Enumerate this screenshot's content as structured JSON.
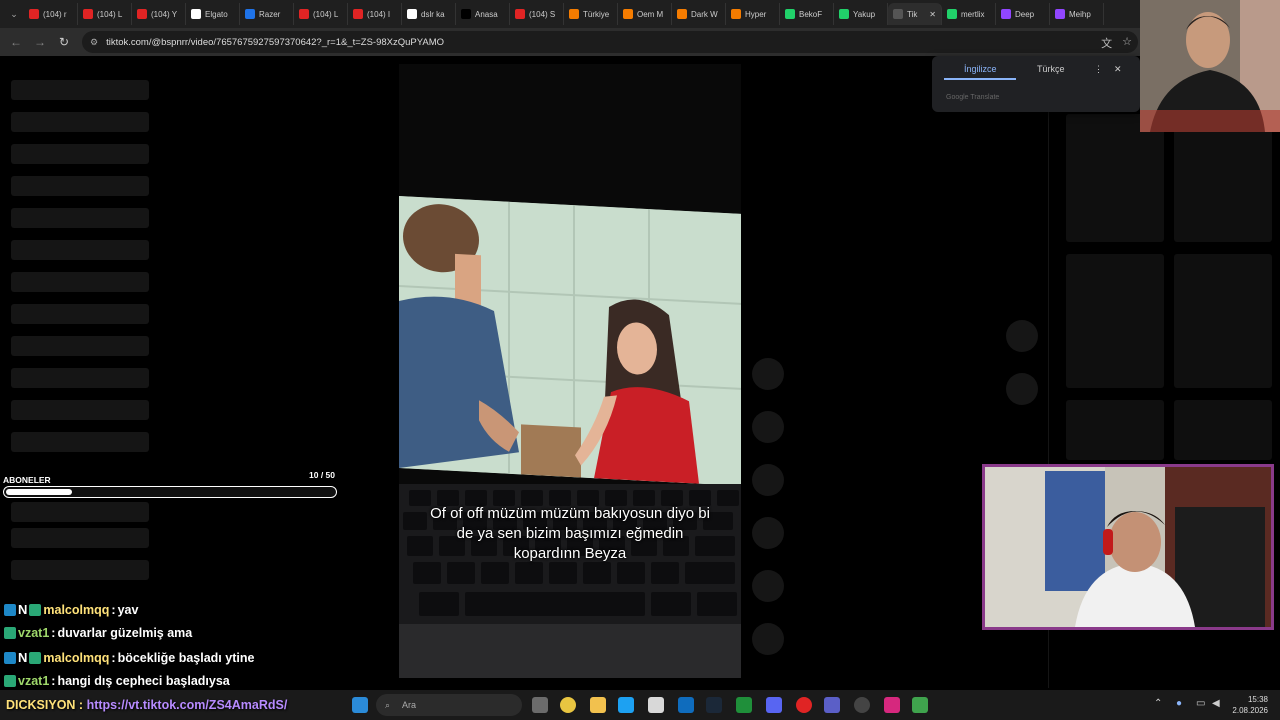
{
  "browser": {
    "tabs": [
      {
        "label": "(104) r",
        "color": "#e02424"
      },
      {
        "label": "(104) L",
        "color": "#e02424"
      },
      {
        "label": "(104) Y",
        "color": "#e02424"
      },
      {
        "label": "Elgato",
        "color": "#ffffff"
      },
      {
        "label": "Razer",
        "color": "#1f73e8"
      },
      {
        "label": "(104) L",
        "color": "#e02424"
      },
      {
        "label": "(104) I",
        "color": "#e02424"
      },
      {
        "label": "dslr ka",
        "color": "#ffffff"
      },
      {
        "label": "Anasa",
        "color": "#000000"
      },
      {
        "label": "(104) S",
        "color": "#e02424"
      },
      {
        "label": "Türkiye",
        "color": "#f57c00"
      },
      {
        "label": "Oem M",
        "color": "#f57c00"
      },
      {
        "label": "Dark W",
        "color": "#f57c00"
      },
      {
        "label": "Hyper",
        "color": "#f57c00"
      },
      {
        "label": "BekoF",
        "color": "#21d16a"
      },
      {
        "label": "Yakup",
        "color": "#21d16a"
      },
      {
        "label": "Tik",
        "color": "#555555",
        "active": true
      },
      {
        "label": "mertlix",
        "color": "#21d16a"
      },
      {
        "label": "Deep",
        "color": "#9146ff"
      },
      {
        "label": "Meihp",
        "color": "#9146ff"
      }
    ],
    "url": "tiktok.com/@bspnrr/video/7657675927597370642?_r=1&_t=ZS-98XzQuPYAMO"
  },
  "translate_popup": {
    "lang_from": "İngilizce",
    "lang_to": "Türkçe",
    "footer": "Google Translate"
  },
  "video": {
    "caption": "Of of off müzüm müzüm bakıyosun diyo bi de ya sen bizim başımızı eğmedin kopardınn Beyza"
  },
  "subscribers": {
    "label": "ABONELER",
    "count_text": "10 / 50",
    "progress": 0.2
  },
  "chat": [
    {
      "badge": "N",
      "user": "malcolmqq",
      "message": "yav"
    },
    {
      "badge": "",
      "user": "vzat1",
      "message": "duvarlar güzelmiş ama"
    },
    {
      "badge": "N",
      "user": "malcolmqq",
      "message": "böcekliğe başladı ytine"
    },
    {
      "badge": "",
      "user": "vzat1",
      "message": "hangi dış cepheci başladıysa"
    }
  ],
  "ticker": {
    "label": "DICKSIYON :",
    "url": "https://vt.tiktok.com/ZS4AmaRdS/"
  },
  "taskbar": {
    "search_placeholder": "Ara",
    "time": "15:38",
    "date": "2.08.2026"
  }
}
